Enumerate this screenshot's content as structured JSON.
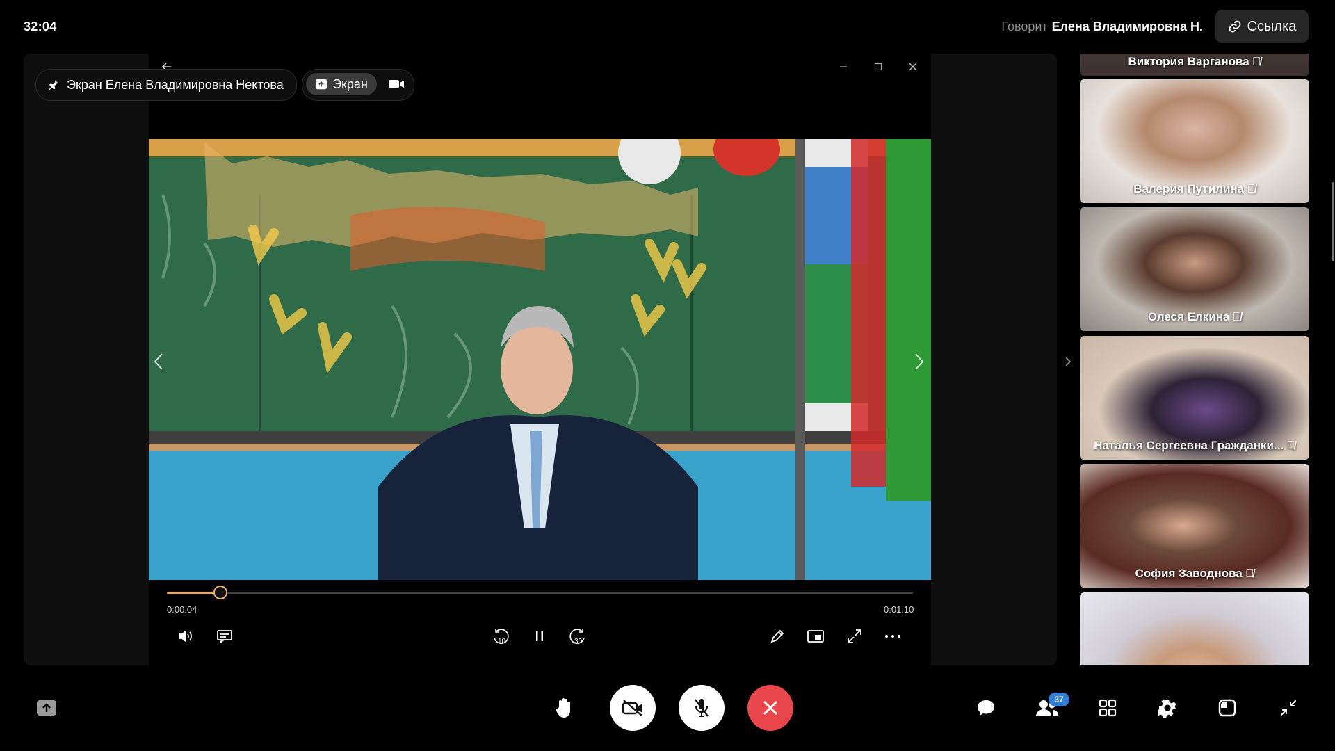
{
  "topbar": {
    "clock": "32:04",
    "speaker_label": "Говорит",
    "speaker_name": "Елена Владимировна Н.",
    "link_label": "Ссылка"
  },
  "stage": {
    "pinned_label": "Экран Елена Владимировна Нектова",
    "screen_label": "Экран"
  },
  "player": {
    "current_time": "0:00:04",
    "duration": "0:01:10",
    "progress": 0.072,
    "rewind_seconds": "10",
    "forward_seconds": "30"
  },
  "participants": [
    {
      "name": "Виктория Варганова",
      "muted": true
    },
    {
      "name": "Валерия Путилина",
      "muted": true
    },
    {
      "name": "Олеся Елкина",
      "muted": true
    },
    {
      "name": "Наталья Сергеевна Гражданки...",
      "muted": true
    },
    {
      "name": "София Заводнова",
      "muted": true
    },
    {
      "name": "",
      "muted": false
    }
  ],
  "bottombar": {
    "participants_count": "37"
  },
  "colors": {
    "end_call": "#e9474b",
    "accent_progress": "#e8a76b",
    "badge": "#2f7fd8"
  },
  "icons": [
    "pin-icon",
    "link-icon",
    "share-screen-icon",
    "camera-icon",
    "arrow-left-icon",
    "minimize-icon",
    "maximize-icon",
    "close-icon",
    "volume-icon",
    "subtitles-icon",
    "rewind-icon",
    "pause-icon",
    "forward-icon",
    "pencil-icon",
    "pip-icon",
    "fullscreen-icon",
    "more-icon",
    "raise-hand-icon",
    "camera-off-icon",
    "mic-off-icon",
    "end-call-icon",
    "chat-icon",
    "participants-icon",
    "grid-icon",
    "settings-icon",
    "layout-icon",
    "collapse-icon"
  ]
}
